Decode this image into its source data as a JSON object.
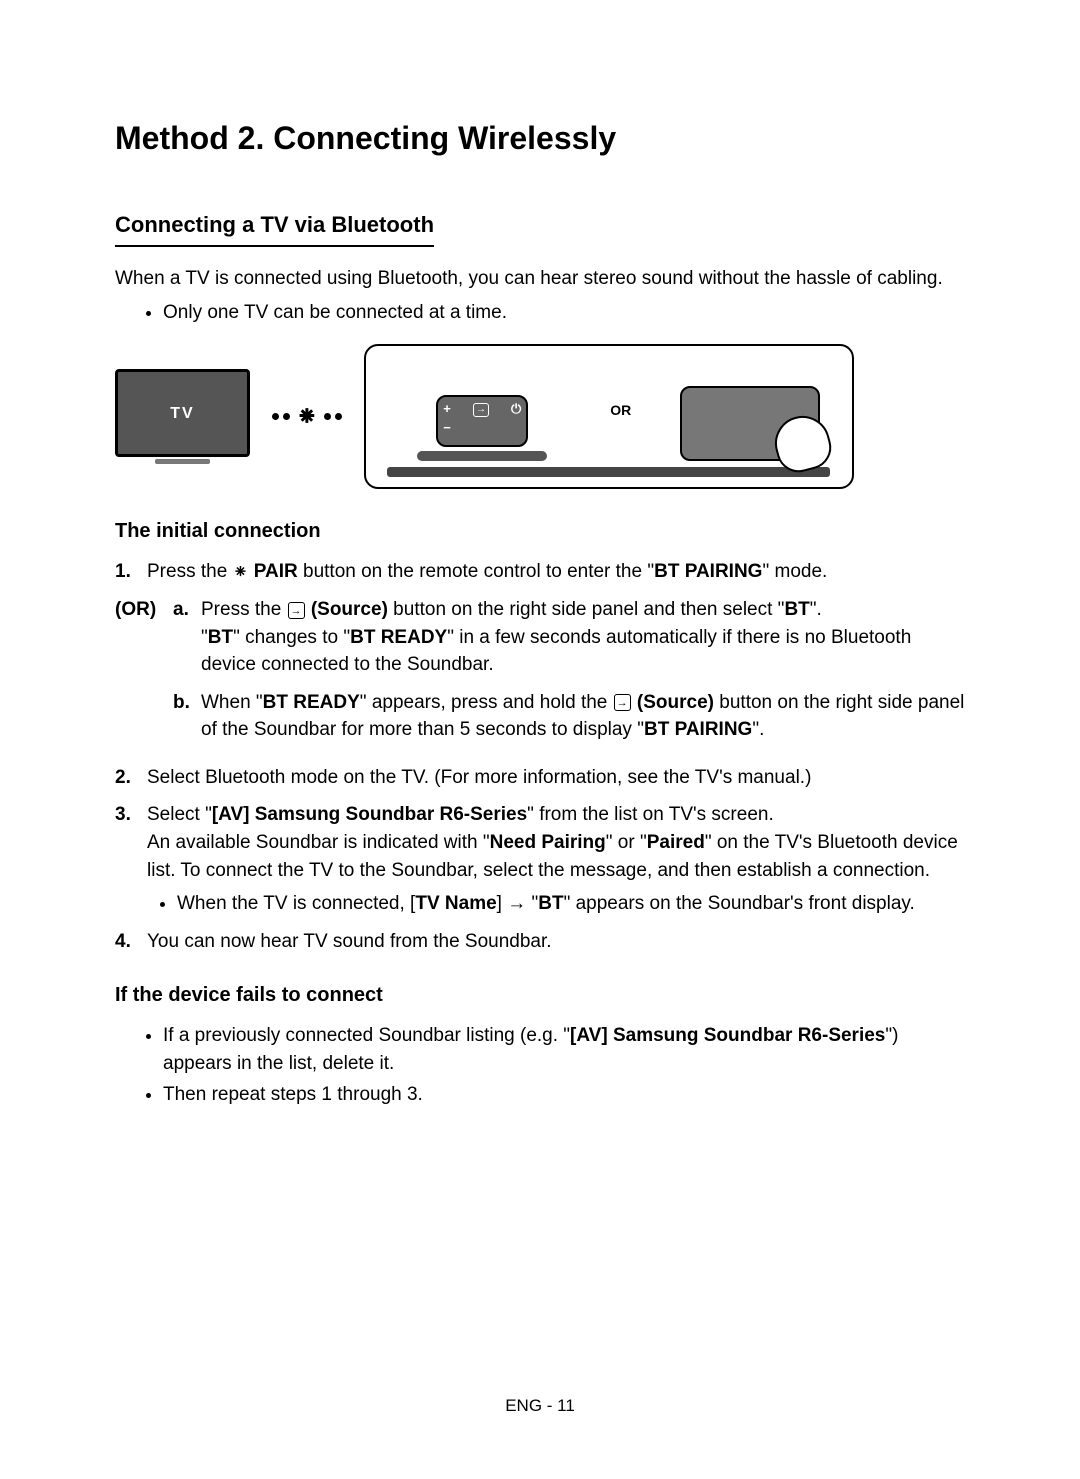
{
  "title": "Method 2. Connecting Wirelessly",
  "section1": {
    "heading": "Connecting a TV via Bluetooth",
    "intro": "When a TV is connected using Bluetooth, you can hear stereo sound without the hassle of cabling.",
    "bullet1": "Only one TV can be connected at a time."
  },
  "figure": {
    "tv_label": "TV",
    "or_label": "OR",
    "remote_plus": "+",
    "remote_minus": "−",
    "remote_power": "⏻"
  },
  "initial": {
    "heading": "The initial connection",
    "step1_num": "1.",
    "step1_a": "Press the ",
    "step1_pair": " PAIR",
    "step1_b": " button on the remote control to enter the \"",
    "step1_bold": "BT PAIRING",
    "step1_c": "\" mode.",
    "or_label": "(OR)",
    "sub_a_letter": "a.",
    "sub_a_1": "Press the ",
    "sub_a_source": " (Source)",
    "sub_a_2": " button on the right side panel and then select \"",
    "sub_a_bt": "BT",
    "sub_a_3": "\".",
    "sub_a_line2_a": "\"",
    "sub_a_line2_bt": "BT",
    "sub_a_line2_b": "\" changes to \"",
    "sub_a_line2_ready": "BT READY",
    "sub_a_line2_c": "\" in a few seconds automatically if there is no Bluetooth device connected to the Soundbar.",
    "sub_b_letter": "b.",
    "sub_b_1": "When \"",
    "sub_b_ready": "BT READY",
    "sub_b_2": "\" appears, press and hold the ",
    "sub_b_source": " (Source)",
    "sub_b_3": " button on the right side panel of the Soundbar for more than 5 seconds to display \"",
    "sub_b_pairing": "BT PAIRING",
    "sub_b_4": "\".",
    "step2_num": "2.",
    "step2": "Select Bluetooth mode on the TV. (For more information, see the TV's manual.)",
    "step3_num": "3.",
    "step3_a": "Select \"",
    "step3_bold1": "[AV] Samsung Soundbar R6-Series",
    "step3_b": "\" from the list on TV's screen.",
    "step3_line2_a": "An available Soundbar is indicated with \"",
    "step3_need": "Need Pairing",
    "step3_line2_b": "\" or \"",
    "step3_paired": "Paired",
    "step3_line2_c": "\" on the TV's Bluetooth device list. To connect the TV to the Soundbar, select the message, and then establish a connection.",
    "step3_bullet_a": "When the TV is connected, [",
    "step3_tvname": "TV Name",
    "step3_bullet_b": "] → \"",
    "step3_bt": "BT",
    "step3_bullet_c": "\" appears on the Soundbar's front display.",
    "step4_num": "4.",
    "step4": "You can now hear TV sound from the Soundbar."
  },
  "fails": {
    "heading": "If the device fails to connect",
    "b1_a": "If a previously connected Soundbar listing (e.g. \"",
    "b1_bold": "[AV] Samsung Soundbar R6-Series",
    "b1_b": "\") appears in the list, delete it.",
    "b2": "Then repeat steps 1 through 3."
  },
  "footer": "ENG - 11"
}
